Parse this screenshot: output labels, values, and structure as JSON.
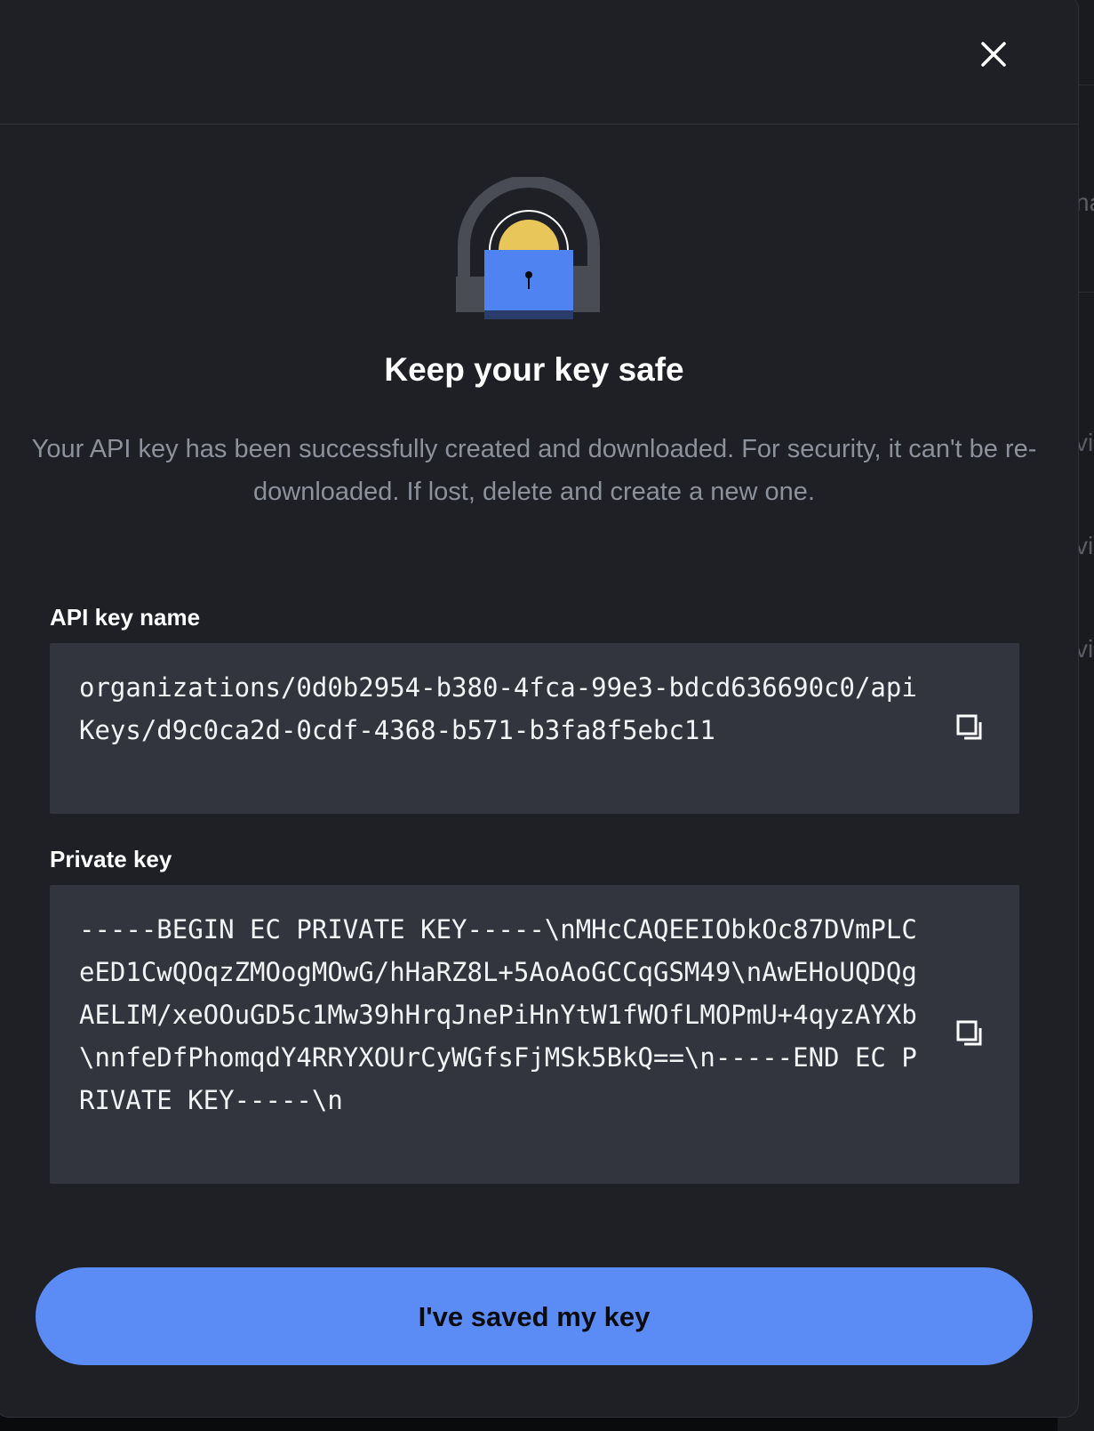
{
  "modal": {
    "title": "Keep your key safe",
    "description": "Your API key has been successfully created and downloaded. For security, it can't be re-downloaded. If lost, delete and create a new one.",
    "fields": {
      "api_key_name": {
        "label": "API key name",
        "value": "organizations/0d0b2954-b380-4fca-99e3-bdcd636690c0/apiKeys/d9c0ca2d-0cdf-4368-b571-b3fa8f5ebc11",
        "copy_icon": "copy-icon"
      },
      "private_key": {
        "label": "Private key",
        "value": "-----BEGIN EC PRIVATE KEY-----\\nMHcCAQEEIObkOc87DVmPLCeED1CwQOqzZMOogMOwG/hHaRZ8L+5AoAoGCCqGSM49\\nAwEHoUQDQgAELIM/xeOOuGD5c1Mw39hHrqJnePiHnYtW1fWOfLMOPmU+4qyzAYXb\\nnfeDfPhomqdY4RRYXOUrCyWGfsFjMSk5BkQ==\\n-----END EC PRIVATE KEY-----\\n",
        "copy_icon": "copy-icon"
      }
    },
    "confirm_button": "I've saved my key",
    "close_icon": "close-icon",
    "hero_icon": "lock-icon"
  },
  "background_fragments": [
    "na",
    "vi",
    "vi",
    "vi"
  ],
  "colors": {
    "accent": "#5b8cf5",
    "modal_bg": "#1e2025",
    "field_bg": "#32353d",
    "lock_body": "#4f83f1",
    "lock_shackle": "#e8c65a",
    "lock_arch": "#4a4c55"
  }
}
